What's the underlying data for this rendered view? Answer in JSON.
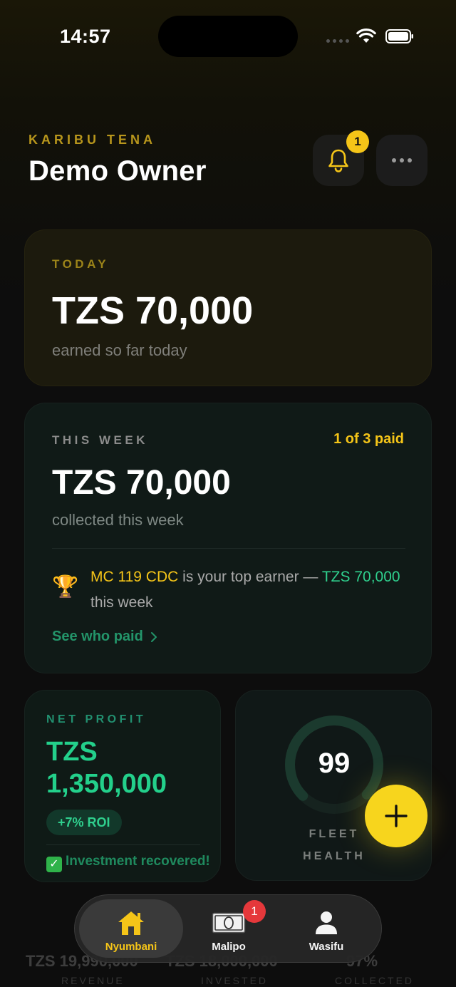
{
  "status_bar": {
    "time": "14:57"
  },
  "header": {
    "greeting": "KARIBU TENA",
    "owner_name": "Demo Owner",
    "notification_count": "1"
  },
  "today": {
    "label": "TODAY",
    "amount": "TZS 70,000",
    "subtitle": "earned so far today"
  },
  "week": {
    "label": "THIS WEEK",
    "paid_status": "1 of 3 paid",
    "amount": "TZS 70,000",
    "subtitle": "collected this week",
    "top_earner_vehicle": "MC 119 CDC",
    "top_earner_text": " is your top earner — ",
    "top_earner_amount": "TZS 70,000",
    "top_earner_suffix": " this week",
    "see_who_paid": "See who paid"
  },
  "net_profit": {
    "label": "NET PROFIT",
    "currency": "TZS",
    "amount": "1,350,000",
    "roi": "+7% ROI",
    "recovered": "Investment recovered!"
  },
  "fleet_health": {
    "score": "99",
    "score_fraction": 0.99,
    "label": "FLEET HEALTH"
  },
  "bottom_stats": [
    {
      "value": "TZS 19,990,000",
      "label": "REVENUE"
    },
    {
      "value": "TZS 18,000,000",
      "label": "INVESTED"
    },
    {
      "value": "97%",
      "label": "COLLECTED"
    }
  ],
  "tabs": [
    {
      "label": "Nyumbani",
      "icon": "home-icon",
      "active": true
    },
    {
      "label": "Malipo",
      "icon": "cash-icon",
      "badge": "1"
    },
    {
      "label": "Wasifu",
      "icon": "person-icon"
    }
  ],
  "colors": {
    "accent_yellow": "#f5c518",
    "accent_green": "#23d08b",
    "badge_red": "#e5383b",
    "background": "#0d0d0d"
  }
}
